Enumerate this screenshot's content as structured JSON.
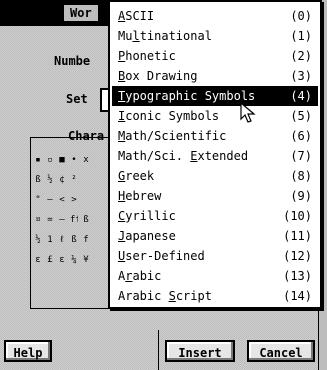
{
  "dialog": {
    "title": "Wor",
    "number_label": "Numbe",
    "set_label": "Set",
    "charset_group_label": "Chara",
    "help_button": "Help",
    "insert_button": "Insert",
    "cancel_button": "Cancel"
  },
  "char_grid": [
    [
      "▪",
      "▫",
      "■",
      "•",
      "x"
    ],
    [
      "ß",
      "½",
      "¢",
      "²",
      ""
    ],
    [
      "\"",
      "–",
      "<",
      ">",
      ""
    ],
    [
      "¤",
      "=",
      "–",
      "ff",
      "ß"
    ],
    [
      "½",
      "1",
      "ℓ",
      "ß",
      "f"
    ],
    [
      "ε",
      "£",
      "ε",
      "¼",
      "¥"
    ]
  ],
  "menu": {
    "items": [
      {
        "prefix": "",
        "ul": "A",
        "rest": "SCII",
        "code": "(0)"
      },
      {
        "prefix": "Mu",
        "ul": "l",
        "rest": "tinational",
        "code": "(1)"
      },
      {
        "prefix": "",
        "ul": "P",
        "rest": "honetic",
        "code": "(2)"
      },
      {
        "prefix": "",
        "ul": "B",
        "rest": "ox Drawing",
        "code": "(3)"
      },
      {
        "prefix": "",
        "ul": "T",
        "rest": "ypographic Symbols",
        "code": "(4)",
        "selected": true
      },
      {
        "prefix": "",
        "ul": "I",
        "rest": "conic Symbols",
        "code": "(5)"
      },
      {
        "prefix": "",
        "ul": "M",
        "rest": "ath/Scientific",
        "code": "(6)"
      },
      {
        "prefix": "Math/Sci. ",
        "ul": "E",
        "rest": "xtended",
        "code": "(7)"
      },
      {
        "prefix": "",
        "ul": "G",
        "rest": "reek",
        "code": "(8)"
      },
      {
        "prefix": "",
        "ul": "H",
        "rest": "ebrew",
        "code": "(9)"
      },
      {
        "prefix": "",
        "ul": "C",
        "rest": "yrillic",
        "code": "(10)"
      },
      {
        "prefix": "",
        "ul": "J",
        "rest": "apanese",
        "code": "(11)"
      },
      {
        "prefix": "",
        "ul": "U",
        "rest": "ser-Defined",
        "code": "(12)"
      },
      {
        "prefix": "A",
        "ul": "r",
        "rest": "abic",
        "code": "(13)"
      },
      {
        "prefix": "Arabic ",
        "ul": "S",
        "rest": "cript",
        "code": "(14)"
      }
    ]
  }
}
